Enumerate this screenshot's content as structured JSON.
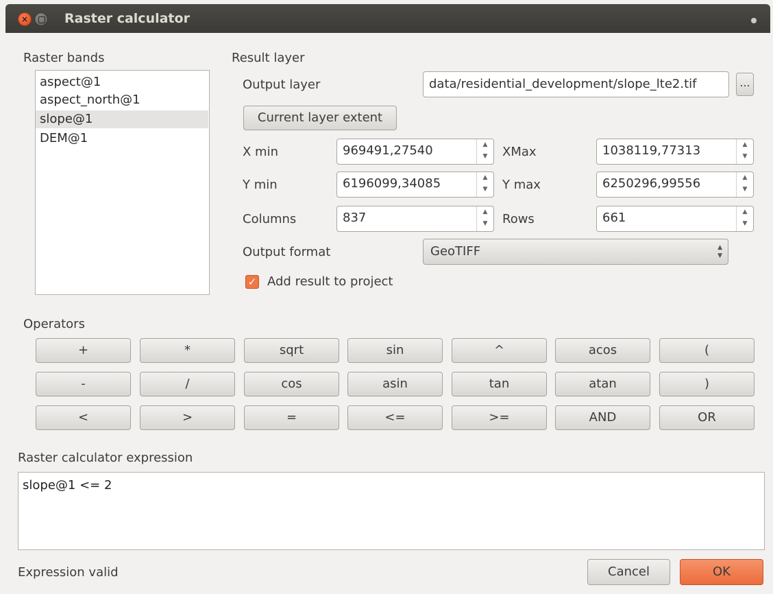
{
  "window": {
    "title": "Raster calculator",
    "close_glyph": "×"
  },
  "raster_bands": {
    "label": "Raster bands",
    "items": [
      "aspect@1",
      "aspect_north@1",
      "slope@1",
      "DEM@1"
    ],
    "selected": "slope@1"
  },
  "result_layer": {
    "label": "Result layer",
    "output_layer_label": "Output layer",
    "output_layer_value": "data/residential_development/slope_lte2.tif",
    "browse_label": "...",
    "current_extent_label": "Current layer extent",
    "xmin_label": "X min",
    "xmin_value": "969491,27540",
    "xmax_label": "XMax",
    "xmax_value": "1038119,77313",
    "ymin_label": "Y min",
    "ymin_value": "6196099,34085",
    "ymax_label": "Y max",
    "ymax_value": "6250296,99556",
    "columns_label": "Columns",
    "columns_value": "837",
    "rows_label": "Rows",
    "rows_value": "661",
    "format_label": "Output format",
    "format_value": "GeoTIFF",
    "add_to_project_label": "Add result to project",
    "add_to_project_checked": true
  },
  "operators": {
    "label": "Operators",
    "rows": [
      [
        "+",
        "*",
        "sqrt",
        "sin",
        "^",
        "acos",
        "("
      ],
      [
        "-",
        "/",
        "cos",
        "asin",
        "tan",
        "atan",
        ")"
      ],
      [
        "<",
        ">",
        "=",
        "<=",
        ">=",
        "AND",
        "OR"
      ]
    ]
  },
  "expression": {
    "label": "Raster calculator expression",
    "value": "slope@1 <= 2",
    "status": "Expression valid"
  },
  "buttons": {
    "cancel": "Cancel",
    "ok": "OK",
    "ok_color": "#f07746"
  }
}
